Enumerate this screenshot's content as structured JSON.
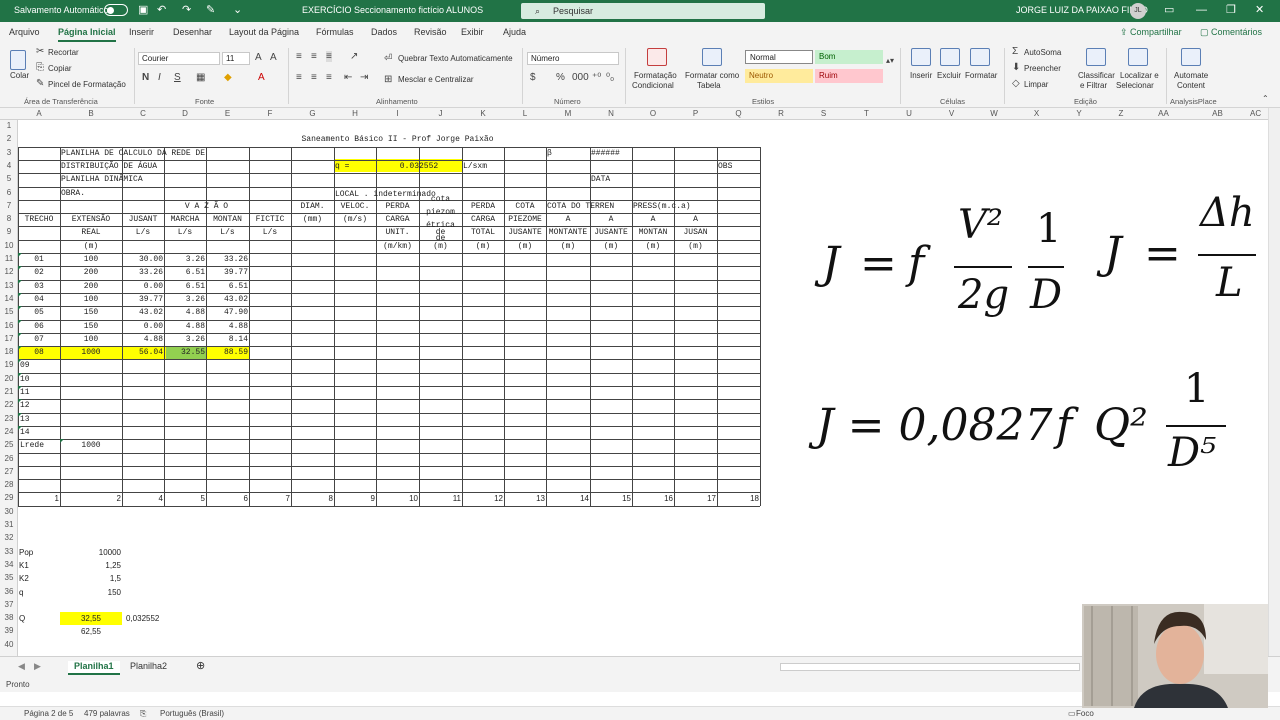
{
  "titlebar": {
    "autosave_label": "Salvamento Automático",
    "file_title": "EXERCÍCIO Seccionamento fictício ALUNOS",
    "search_placeholder": "Pesquisar",
    "user_name": "JORGE LUIZ DA PAIXAO FILHO",
    "user_initials": "JL"
  },
  "menu_tabs": [
    "Arquivo",
    "Página Inicial",
    "Inserir",
    "Desenhar",
    "Layout da Página",
    "Fórmulas",
    "Dados",
    "Revisão",
    "Exibir",
    "Ajuda"
  ],
  "menu_share": "Compartilhar",
  "menu_comments": "Comentários",
  "ribbon": {
    "paste": "Colar",
    "cut": "Recortar",
    "copy": "Copiar",
    "format_painter": "Pincel de Formatação",
    "clipboard": "Área de Transferência",
    "font_name": "Courier",
    "font_size": "11",
    "font_group": "Fonte",
    "wrap_text": "Quebrar Texto Automaticamente",
    "merge_center": "Mesclar e Centralizar",
    "alignment": "Alinhamento",
    "number_format": "Número",
    "number_group": "Número",
    "cond_format_1": "Formatação",
    "cond_format_2": "Condicional",
    "format_table_1": "Formatar como",
    "format_table_2": "Tabela",
    "style_normal": "Normal",
    "style_bom": "Bom",
    "style_neutro": "Neutro",
    "style_ruim": "Ruim",
    "styles_group": "Estilos",
    "insert": "Inserir",
    "delete": "Excluir",
    "format": "Formatar",
    "cells_group": "Células",
    "autosum": "AutoSoma",
    "fill": "Preencher",
    "clear": "Limpar",
    "sort_1": "Classificar",
    "sort_2": "e Filtrar",
    "find_1": "Localizar e",
    "find_2": "Selecionar",
    "edit_group": "Edição",
    "automate_1": "Automate",
    "automate_2": "Content",
    "analysis_group": "AnalysisPlace"
  },
  "columns": [
    "A",
    "B",
    "C",
    "D",
    "E",
    "F",
    "G",
    "H",
    "I",
    "J",
    "K",
    "L",
    "M",
    "N",
    "O",
    "P",
    "Q",
    "R",
    "S",
    "T",
    "U",
    "V",
    "W",
    "X",
    "Y",
    "Z",
    "AA",
    "AB",
    "AC"
  ],
  "rows": [
    "1",
    "2",
    "3",
    "4",
    "5",
    "6",
    "7",
    "8",
    "9",
    "10",
    "11",
    "12",
    "13",
    "14",
    "15",
    "16",
    "17",
    "18",
    "19",
    "20",
    "21",
    "22",
    "23",
    "24",
    "25",
    "26",
    "27",
    "28",
    "29",
    "30",
    "31",
    "32",
    "33",
    "34",
    "35",
    "36",
    "37",
    "38",
    "39",
    "40"
  ],
  "sheet": {
    "title": "Saneamento Básico II - Prof Jorge Paixão",
    "h3": "PLANILHA DE CALCULO DA REDE DE",
    "h4": "DISTRIBUIÇÃO DE ÁGUA",
    "h5": "PLANILHA DINÂMICA",
    "h6": "OBRA.",
    "q_label": "q =",
    "q_value": "0.032552",
    "q_unit": "L/sxm",
    "beta": "β",
    "hash": "######",
    "obs": "OBS",
    "data": "DATA",
    "local": "LOCAL . indeterminado",
    "vazao": "V A Z Ã O",
    "diam": "DIAM.",
    "veloc": "VELOC.",
    "perda": "PERDA",
    "cota_p1": "cota",
    "cota_p2": "piezom",
    "cota_p3": "étrica",
    "cota_p4": "de",
    "perda_k": "PERDA",
    "cota_l": "COTA",
    "cota_terreno": "COTA DO TERREN",
    "press": "PRESS(m.c.a)",
    "trecho": "TRECHO",
    "extensao": "EXTENSÃO",
    "jusant": "JUSANT",
    "marcha": "MARCHA",
    "montan": "MONTAN",
    "fictic": "FICTIC",
    "mm": "(mm)",
    "ms": "(m/s)",
    "carga": "CARGA",
    "carga_k": "CARGA",
    "piezome": "PIEZOME",
    "a_m": "A",
    "a_n": "A",
    "a_o": "A",
    "a_p": "A",
    "real": "REAL",
    "ls_c": "L/s",
    "ls_d": "L/s",
    "ls_e": "L/s",
    "ls_f": "L/s",
    "unit": "UNIT.",
    "de": "de",
    "total": "TOTAL",
    "jusante_l": "JUSANTE",
    "montante_m": "MONTANTE",
    "jusante_n": "JUSANTE",
    "montan_o": "MONTAN",
    "jusan_p": "JUSAN",
    "m_b": "(m)",
    "mkm": "(m/km)",
    "m_j": "(m)",
    "m_k": "(m)",
    "m_l": "(m)",
    "m_m": "(m)",
    "m_n": "(m)",
    "m_o": "(m)",
    "m_p": "(m)",
    "data_rows": [
      [
        "01",
        "100",
        "30.00",
        "3.26",
        "33.26"
      ],
      [
        "02",
        "200",
        "33.26",
        "6.51",
        "39.77"
      ],
      [
        "03",
        "200",
        "0.00",
        "6.51",
        "6.51"
      ],
      [
        "04",
        "100",
        "39.77",
        "3.26",
        "43.02"
      ],
      [
        "05",
        "150",
        "43.02",
        "4.88",
        "47.90"
      ],
      [
        "06",
        "150",
        "0.00",
        "4.88",
        "4.88"
      ],
      [
        "07",
        "100",
        "4.88",
        "3.26",
        "8.14"
      ],
      [
        "08",
        "1000",
        "56.04",
        "32.55",
        "88.59"
      ]
    ],
    "empty_trechos": [
      "09",
      "10",
      "11",
      "12",
      "13",
      "14"
    ],
    "lrede": "Lrede",
    "lrede_val": "1000",
    "numbers_row": [
      "1",
      "2",
      "4",
      "5",
      "6",
      "7",
      "8",
      "9",
      "10",
      "11",
      "12",
      "13",
      "14",
      "15",
      "16",
      "17",
      "18"
    ],
    "pop_label": "Pop",
    "pop_val": "10000",
    "k1_label": "K1",
    "k1_val": "1,25",
    "k2_label": "K2",
    "k2_val": "1,5",
    "qpc_label": "q",
    "qpc_val": "150",
    "Q_label": "Q",
    "Q_val": "32,55",
    "Q_div": "0,032552",
    "Q2": "62,55"
  },
  "formulas": {
    "f1_J": "J",
    "f1_eq": "=",
    "f1_f": "f",
    "f1_num": "V²",
    "f1_den": "2g",
    "f1_one": "1",
    "f1_D": "D",
    "f2_J": "J",
    "f2_eq": "=",
    "f2_num": "Δh",
    "f2_den": "L",
    "f3_left": "J = 0,0827",
    "f3_f": "f",
    "f3_Q": "Q²",
    "f3_one": "1",
    "f3_den": "D⁵"
  },
  "sheet_tabs": [
    "Planilha1",
    "Planilha2"
  ],
  "status": "Pronto",
  "word_status": {
    "page": "Página 2 de 5",
    "words": "479 palavras",
    "lang": "Português (Brasil)",
    "focus": "Foco"
  }
}
